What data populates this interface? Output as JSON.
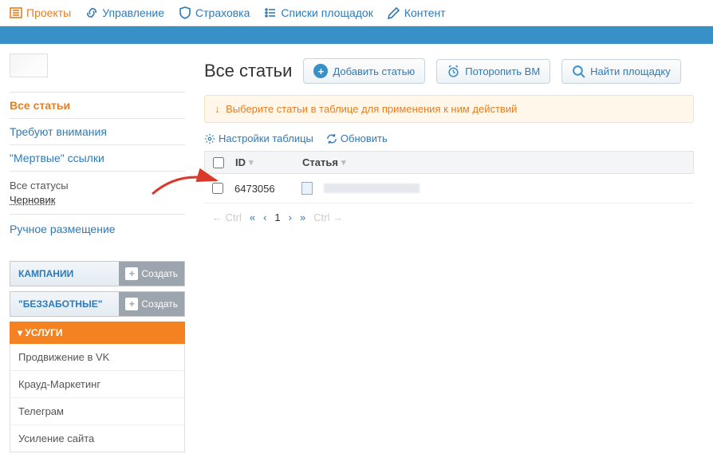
{
  "topnav": {
    "projects": "Проекты",
    "management": "Управление",
    "insurance": "Страховка",
    "lists": "Списки площадок",
    "content": "Контент"
  },
  "sidebar": {
    "links": {
      "all_articles": "Все статьи",
      "need_attention": "Требуют внимания",
      "dead_links": "\"Мертвые\" ссылки"
    },
    "statuses": {
      "all": "Все статусы",
      "draft": "Черновик",
      "count": ""
    },
    "manual": "Ручное размещение",
    "accordion": {
      "campaigns": "КАМПАНИИ",
      "carefree": "\"БЕЗЗАБОТНЫЕ\"",
      "create": "Создать"
    },
    "services": {
      "header": "▾ УСЛУГИ",
      "items": [
        "Продвижение в VK",
        "Крауд-Маркетинг",
        "Телеграм",
        "Усиление сайта"
      ]
    }
  },
  "main": {
    "title": "Все статьи",
    "buttons": {
      "add_article": "Добавить статью",
      "hurry_wm": "Поторопить ВМ",
      "find_site": "Найти площадку"
    },
    "notice": "Выберите статьи в таблице для применения к ним действий",
    "tools": {
      "settings": "Настройки таблицы",
      "refresh": "Обновить"
    },
    "columns": {
      "id": "ID",
      "article": "Статья"
    },
    "rows": [
      {
        "id": "6473056"
      }
    ],
    "pagination": {
      "ctrl_left": "← Ctrl",
      "first": "«",
      "prev": "‹",
      "page": "1",
      "next": "›",
      "last": "»",
      "ctrl_right": "Ctrl →"
    }
  }
}
